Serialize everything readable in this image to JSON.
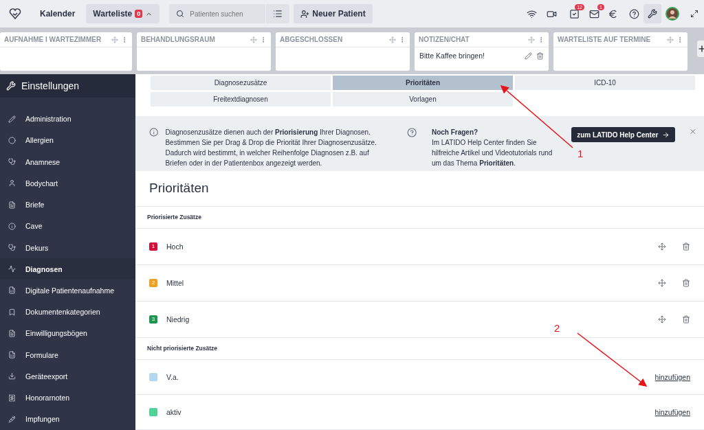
{
  "topbar": {
    "nav": [
      {
        "label": "Kalender",
        "selected": false
      },
      {
        "label": "Warteliste",
        "selected": true,
        "badge": "0"
      }
    ],
    "search": {
      "placeholder": "Patienten suchen"
    },
    "new_patient": "Neuer Patient",
    "badges": {
      "tasks": "12",
      "mail": "1"
    }
  },
  "board": {
    "columns": [
      {
        "title": "AUFNAHME I WARTEZIMMER"
      },
      {
        "title": "BEHANDLUNGSRAUM"
      },
      {
        "title": "ABGESCHLOSSEN"
      },
      {
        "title": "NOTIZEN/CHAT",
        "notes": [
          "Bitte Kaffee bringen!"
        ]
      },
      {
        "title": "WARTELISTE AUF TERMINE"
      }
    ]
  },
  "sidebar": {
    "title": "Einstellungen",
    "items": [
      {
        "label": "Administration",
        "selected": false
      },
      {
        "label": "Allergien",
        "selected": false
      },
      {
        "label": "Anamnese",
        "selected": false
      },
      {
        "label": "Bodychart",
        "selected": false
      },
      {
        "label": "Briefe",
        "selected": false
      },
      {
        "label": "Cave",
        "selected": false
      },
      {
        "label": "Dekurs",
        "selected": false
      },
      {
        "label": "Diagnosen",
        "selected": true
      },
      {
        "label": "Digitale Patientenaufnahme",
        "selected": false
      },
      {
        "label": "Dokumentenkategorien",
        "selected": false
      },
      {
        "label": "Einwilligungsbögen",
        "selected": false
      },
      {
        "label": "Formulare",
        "selected": false
      },
      {
        "label": "Geräteexport",
        "selected": false
      },
      {
        "label": "Honorarnoten",
        "selected": false
      },
      {
        "label": "Impfungen",
        "selected": false
      }
    ]
  },
  "tabs": [
    {
      "label": "Diagnosezusätze",
      "selected": false
    },
    {
      "label": "Prioritäten",
      "selected": true
    },
    {
      "label": "ICD-10",
      "selected": false
    },
    {
      "label": "Freitextdiagnosen",
      "selected": false
    },
    {
      "label": "Vorlagen",
      "selected": false
    }
  ],
  "info": {
    "text": "Diagnosenzusätze dienen auch der **Priorisierung** Ihrer Diagnosen. Bestimmen Sie per Drag & Drop die Priorität Ihrer Diagnosenzusätze. Dadurch wird bestimmt, in welcher Reihenfolge Diagnosen z.B. auf Briefen oder in der Patientenbox angezeigt werden.",
    "help_title": "Noch Fragen?",
    "help_text": "Im LATIDO Help Center finden Sie hilfreiche Artikel und Videotutorials rund um das Thema **Prioritäten**.",
    "help_button": "zum LATIDO Help Center"
  },
  "page_title": "Prioritäten",
  "prioritized": {
    "heading": "Priorisierte Zusätze",
    "items": [
      {
        "number": "1",
        "label": "Hoch",
        "color": "#d0103a"
      },
      {
        "number": "2",
        "label": "Mittel",
        "color": "#f0a01e"
      },
      {
        "number": "3",
        "label": "Niedrig",
        "color": "#1e9650"
      }
    ]
  },
  "unprioritized": {
    "heading": "Nicht priorisierte Zusätze",
    "items": [
      {
        "label": "V.a.",
        "color": "#b3d7f0",
        "action": "hinzufügen"
      },
      {
        "label": "aktiv",
        "color": "#4fd19a",
        "action": "hinzufügen"
      }
    ]
  },
  "annotations": [
    {
      "label": "1"
    },
    {
      "label": "2"
    }
  ]
}
